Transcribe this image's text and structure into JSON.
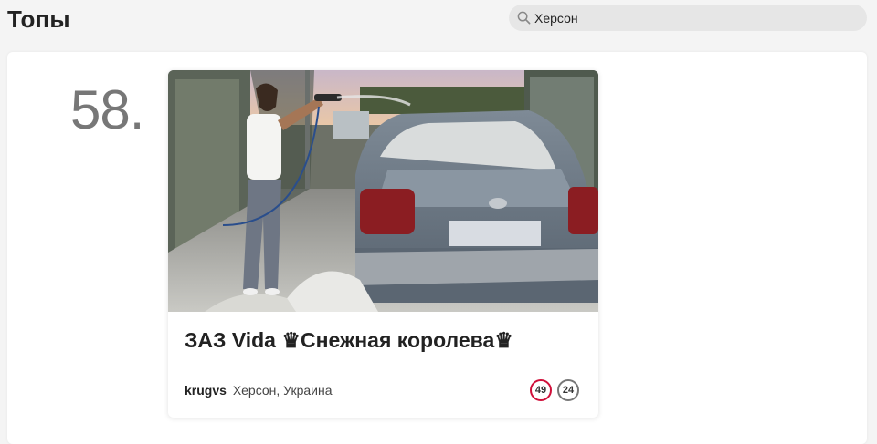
{
  "header": {
    "title": "Топы"
  },
  "search": {
    "value": "Херсон",
    "icon": "search-icon"
  },
  "entry": {
    "rank": "58.",
    "title": "ЗАЗ Vida ♛Снежная королева♛",
    "author": "krugvs",
    "location": "Херсон, Украина",
    "likes": "49",
    "comments": "24"
  },
  "colors": {
    "likes_badge": "#d0103a",
    "comments_badge": "#777777",
    "background": "#f4f4f4"
  }
}
